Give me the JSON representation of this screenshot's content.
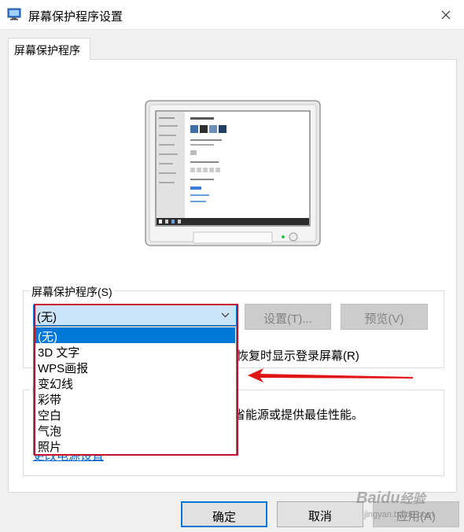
{
  "window": {
    "title": "屏幕保护程序设置",
    "close_glyph": "✕"
  },
  "tabs": [
    {
      "label": "屏幕保护程序"
    }
  ],
  "screensaver": {
    "group_title": "屏幕保护程序(S)",
    "selected_value": "(无)",
    "settings_label": "设置(T)...",
    "preview_label": "预览(V)",
    "options": [
      "(无)",
      "3D 文字",
      "WPS画报",
      "变幻线",
      "彩带",
      "空白",
      "气泡",
      "照片"
    ],
    "resume_text": "恢复时显示登录屏幕(R)"
  },
  "power": {
    "group_title_fragment": "电",
    "description_fragment": "省能源或提供最佳性能。",
    "link_fragment": "更改电源设置"
  },
  "annotation": {
    "frame_color": "#c8102e",
    "arrow_color": "#e01515"
  },
  "footer": {
    "ok_label": "确定",
    "cancel_label": "取消",
    "apply_label": "应用(A)"
  },
  "watermark": {
    "brand": "Baidu",
    "brand_suffix": "经验",
    "url": "jingyan.baidu.com"
  },
  "icons": {
    "app": "screensaver-app-icon",
    "close": "close-icon",
    "dropdown": "chevron-down-icon",
    "arrow": "red-arrow-left-icon"
  }
}
